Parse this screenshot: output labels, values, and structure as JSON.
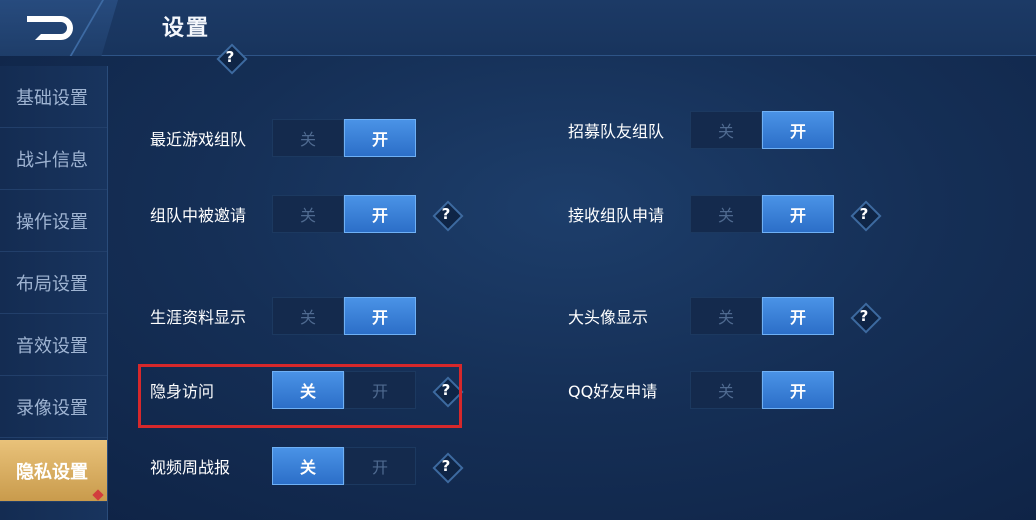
{
  "header": {
    "title": "设置",
    "help_mark": "?"
  },
  "sidebar": {
    "items": [
      {
        "label": "基础设置",
        "active": false
      },
      {
        "label": "战斗信息",
        "active": false
      },
      {
        "label": "操作设置",
        "active": false
      },
      {
        "label": "布局设置",
        "active": false
      },
      {
        "label": "音效设置",
        "active": false
      },
      {
        "label": "录像设置",
        "active": false
      },
      {
        "label": "隐私设置",
        "active": true
      }
    ]
  },
  "toggle_labels": {
    "off": "关",
    "on": "开"
  },
  "settings": [
    {
      "label": "最近游戏组队",
      "state": "on",
      "help": false
    },
    {
      "label": "招募队友组队",
      "state": "on",
      "help": false
    },
    {
      "label": "组队中被邀请",
      "state": "on",
      "help": true
    },
    {
      "label": "接收组队申请",
      "state": "on",
      "help": true
    },
    {
      "label": "生涯资料显示",
      "state": "on",
      "help": false
    },
    {
      "label": "大头像显示",
      "state": "on",
      "help": true
    },
    {
      "label": "隐身访问",
      "state": "off",
      "help": true
    },
    {
      "label": "QQ好友申请",
      "state": "on",
      "help": false
    },
    {
      "label": "视频周战报",
      "state": "off",
      "help": true
    }
  ],
  "colors": {
    "accent": "#3a82d8",
    "active_tab": "#d9ad5f",
    "highlight_border": "#d6282b"
  }
}
